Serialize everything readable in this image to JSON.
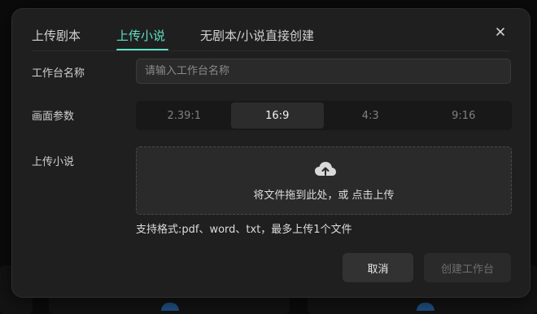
{
  "dialog": {
    "tabs": [
      {
        "label": "上传剧本",
        "active": false
      },
      {
        "label": "上传小说",
        "active": true
      },
      {
        "label": "无剧本/小说直接创建",
        "active": false
      }
    ],
    "close_icon": "close-icon",
    "form": {
      "name_label": "工作台名称",
      "name_value": "",
      "name_placeholder": "请输入工作台名称",
      "ratio_label": "画面参数",
      "ratio_options": [
        "2.39:1",
        "16:9",
        "4:3",
        "9:16"
      ],
      "ratio_selected": "16:9",
      "upload_label": "上传小说",
      "upload_icon": "cloud-upload-icon",
      "upload_text": "将文件拖到此处，或 点击上传",
      "format_hint": "支持格式:pdf、word、txt，最多上传1个文件"
    },
    "buttons": {
      "cancel": "取消",
      "create": "创建工作台"
    }
  },
  "colors": {
    "accent": "#5fe0c6",
    "dialog_bg": "#1f1f1f",
    "page_bg": "#0b0b0b"
  }
}
